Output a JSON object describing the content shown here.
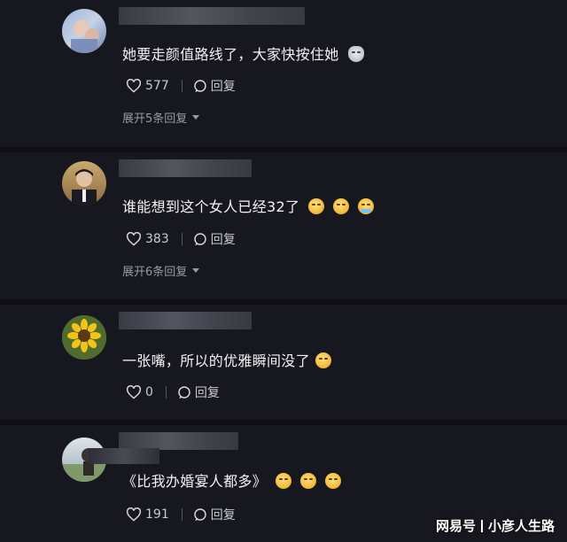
{
  "comments": [
    {
      "text": "她要走颜值路线了，大家快按住她",
      "emoji": [
        "cat-icon"
      ],
      "likes": "577",
      "reply_label": "回复",
      "expand_label": "展开5条回复"
    },
    {
      "text": "谁能想到这个女人已经32了",
      "emoji": [
        "pleading-face",
        "pleading-face",
        "crying-face"
      ],
      "likes": "383",
      "reply_label": "回复",
      "expand_label": "展开6条回复"
    },
    {
      "text": "一张嘴，所以的优雅瞬间没了",
      "emoji": [
        "laughing-crying-face"
      ],
      "likes": "0",
      "reply_label": "回复"
    },
    {
      "text": "《比我办婚宴人都多》",
      "emoji": [
        "pleading-face",
        "pleading-face",
        "pleading-face"
      ],
      "likes": "191",
      "reply_label": "回复"
    }
  ],
  "watermark": {
    "brand": "网易号",
    "account": "小彦人生路"
  }
}
